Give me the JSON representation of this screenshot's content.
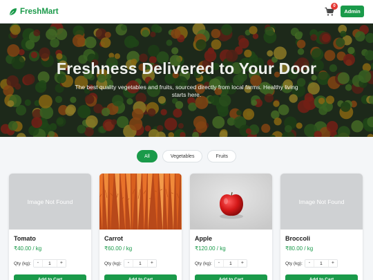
{
  "navbar": {
    "brand": "FreshMart",
    "cart_count": "0",
    "admin_label": "Admin"
  },
  "hero": {
    "title": "Freshness Delivered to Your Door",
    "subtitle": "The best quality vegetables and fruits, sourced directly from local farms. Healthy living starts here."
  },
  "filters": [
    {
      "label": "All",
      "active": true
    },
    {
      "label": "Vegetables",
      "active": false
    },
    {
      "label": "Fruits",
      "active": false
    }
  ],
  "products": [
    {
      "name": "Tomato",
      "price": "₹40.00 / kg",
      "image_status": "Image Not Found",
      "qty_label": "Qty (kg):",
      "qty": "1",
      "add_label": "Add to Cart"
    },
    {
      "name": "Carrot",
      "price": "₹60.00 / kg",
      "image_status": "",
      "qty_label": "Qty (kg):",
      "qty": "1",
      "add_label": "Add to Cart"
    },
    {
      "name": "Apple",
      "price": "₹120.00 / kg",
      "image_status": "",
      "qty_label": "Qty (kg):",
      "qty": "1",
      "add_label": "Add to Cart"
    },
    {
      "name": "Broccoli",
      "price": "₹80.00 / kg",
      "image_status": "Image Not Found",
      "qty_label": "Qty (kg):",
      "qty": "1",
      "add_label": "Add to Cart"
    }
  ],
  "qty_controls": {
    "minus": "-",
    "plus": "+"
  },
  "colors": {
    "primary": "#1a9a4a",
    "badge": "#e53935",
    "price": "#1a9a4a"
  }
}
